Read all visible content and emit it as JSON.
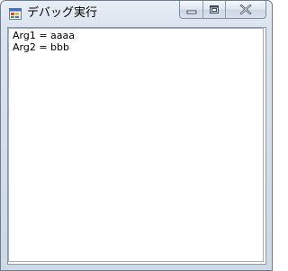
{
  "window": {
    "title": "デバッグ実行"
  },
  "caption_buttons": {
    "minimize_icon": "minimize-icon",
    "maximize_icon": "maximize-icon",
    "close_icon": "close-icon"
  },
  "output": {
    "lines": [
      "Arg1 = aaaa",
      "Arg2 = bbb"
    ]
  },
  "colors": {
    "frame": "#6d7d90",
    "titlebar": "#dae3ee",
    "client_bg": "#ffffff"
  }
}
